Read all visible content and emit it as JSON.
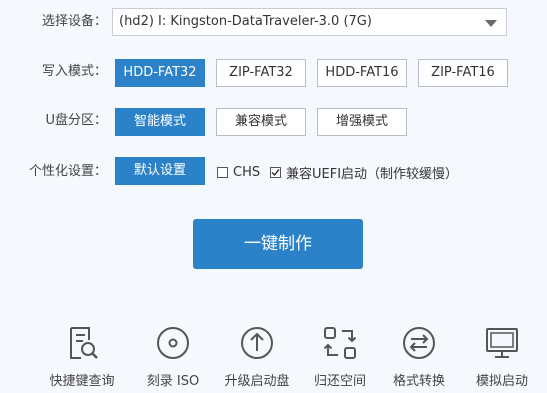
{
  "device": {
    "label": "选择设备：",
    "value": "(hd2) I:  Kingston-DataTraveler-3.0 (7G)"
  },
  "write_mode": {
    "label": "写入模式：",
    "options": [
      "HDD-FAT32",
      "ZIP-FAT32",
      "HDD-FAT16",
      "ZIP-FAT16"
    ],
    "selected": "HDD-FAT32"
  },
  "partition": {
    "label": "U盘分区：",
    "options": [
      "智能模式",
      "兼容模式",
      "增强模式"
    ],
    "selected": "智能模式"
  },
  "personalize": {
    "label": "个性化设置：",
    "default_button": "默认设置",
    "chs": {
      "label": "CHS",
      "checked": false
    },
    "uefi": {
      "label": "兼容UEFI启动（制作较缓慢）",
      "checked": true
    }
  },
  "make_button": "一键制作",
  "tools": [
    {
      "label": "快捷键查询",
      "icon": "document-search-icon"
    },
    {
      "label": "刻录 ISO",
      "icon": "disc-icon"
    },
    {
      "label": "升级启动盘",
      "icon": "upgrade-arrow-icon"
    },
    {
      "label": "归还空间",
      "icon": "restore-space-icon"
    },
    {
      "label": "格式转换",
      "icon": "format-convert-icon"
    },
    {
      "label": "模拟启动",
      "icon": "monitor-icon"
    }
  ],
  "colors": {
    "accent": "#2c82c9",
    "background": "#f5f8fc",
    "icon_stroke": "#555555"
  }
}
